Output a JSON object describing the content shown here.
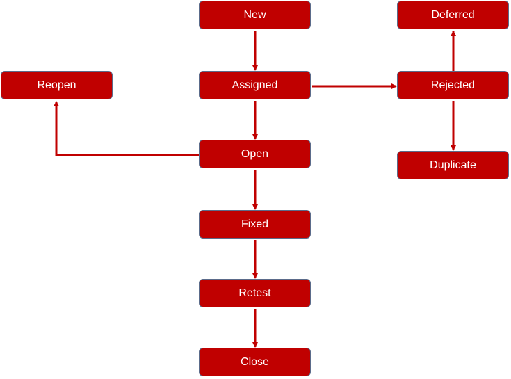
{
  "nodes": {
    "new": "New",
    "assigned": "Assigned",
    "open": "Open",
    "fixed": "Fixed",
    "retest": "Retest",
    "close": "Close",
    "reopen": "Reopen",
    "deferred": "Deferred",
    "rejected": "Rejected",
    "duplicate": "Duplicate"
  },
  "edges": [
    [
      "New",
      "Assigned"
    ],
    [
      "Assigned",
      "Open"
    ],
    [
      "Open",
      "Fixed"
    ],
    [
      "Fixed",
      "Retest"
    ],
    [
      "Retest",
      "Close"
    ],
    [
      "Assigned",
      "Rejected"
    ],
    [
      "Rejected",
      "Deferred"
    ],
    [
      "Rejected",
      "Duplicate"
    ],
    [
      "Open",
      "Reopen"
    ]
  ],
  "colors": {
    "node_fill": "#C00000",
    "node_border": "#5b6b8a",
    "edge": "#C00000",
    "text": "#FFFFFF"
  }
}
